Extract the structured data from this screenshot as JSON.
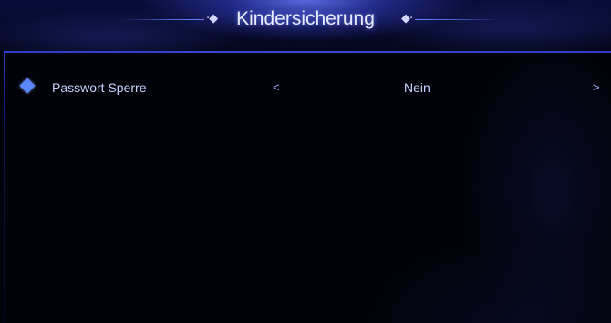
{
  "header": {
    "title": "Kindersicherung",
    "deco_left": "·◆",
    "deco_right": "◆·"
  },
  "menu": {
    "items": [
      {
        "label": "Passwort Sperre",
        "value": "Nein",
        "prev_arrow": "<",
        "next_arrow": ">"
      }
    ]
  },
  "colors": {
    "accent": "#5a86ff",
    "divider": "#3549d8",
    "text": "#c9d3ff",
    "background": "#02030a"
  },
  "icons": {
    "bullet": "diamond-bullet-icon",
    "title_deco": "diamond-ornament-icon"
  }
}
